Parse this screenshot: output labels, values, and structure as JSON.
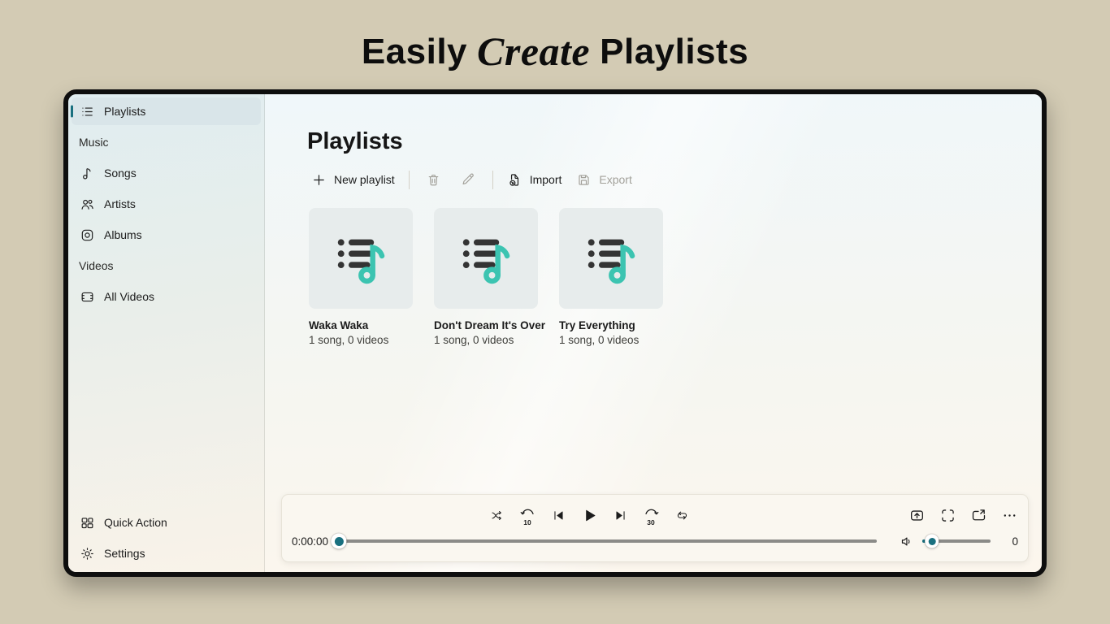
{
  "banner": {
    "title_word_1": "Easily",
    "title_word_italic": "Create",
    "title_word_3": "Playlists"
  },
  "colors": {
    "page_background": "#d3cbb4",
    "accent_teal": "#19707f",
    "note_teal": "#3cc4b1",
    "card_background": "#e7ecec",
    "window_border": "#0e0e0e"
  },
  "icons": {
    "playlist-queue": "dotted list glyph",
    "music-note": "eighth note",
    "people": "two person outlines",
    "album": "rounded square with disc",
    "film-frame": "film strip rectangle",
    "quick-action-grid": "four tiles",
    "gear": "settings gear",
    "plus": "+",
    "trash": "waste bin",
    "pencil": "edit pencil",
    "import": "document with arrow badge",
    "export": "floppy disk",
    "shuffle": "crossed arrows",
    "skip-back": "counterclockwise arc",
    "previous": "bar + left triangle",
    "play": "right triangle",
    "next": "right triangle + bar",
    "skip-forward": "clockwise arc",
    "repeat": "loop arrows",
    "cast": "box with up arrow",
    "fullscreen": "corner brackets",
    "miniplayer": "box with pop-out arrow",
    "more": "ellipsis",
    "speaker": "speaker with wave"
  },
  "sidebar": {
    "items": [
      {
        "label": "Playlists",
        "selected": true,
        "icon": "playlist-queue-icon"
      },
      {
        "label": "Music",
        "section": true
      },
      {
        "label": "Songs",
        "icon": "music-note-icon"
      },
      {
        "label": "Artists",
        "icon": "people-icon"
      },
      {
        "label": "Albums",
        "icon": "album-icon"
      },
      {
        "label": "Videos",
        "section": true
      },
      {
        "label": "All Videos",
        "icon": "film-frame-icon"
      }
    ],
    "footer": [
      {
        "label": "Quick Action",
        "icon": "quick-action-grid-icon"
      },
      {
        "label": "Settings",
        "icon": "gear-icon"
      }
    ]
  },
  "main": {
    "heading": "Playlists",
    "toolbar": {
      "new_playlist_label": "New playlist",
      "import_label": "Import",
      "export_label": "Export"
    },
    "cards": [
      {
        "title": "Waka Waka",
        "subtitle": "1 song, 0 videos"
      },
      {
        "title": "Don't Dream It's Over",
        "subtitle": "1 song, 0 videos"
      },
      {
        "title": "Try Everything",
        "subtitle": "1 song, 0 videos"
      }
    ]
  },
  "player": {
    "elapsed_time": "0:00:00",
    "seek_percent": 0,
    "skip_back_seconds": "10",
    "skip_forward_seconds": "30",
    "volume_value": "0",
    "volume_percent": 12
  }
}
